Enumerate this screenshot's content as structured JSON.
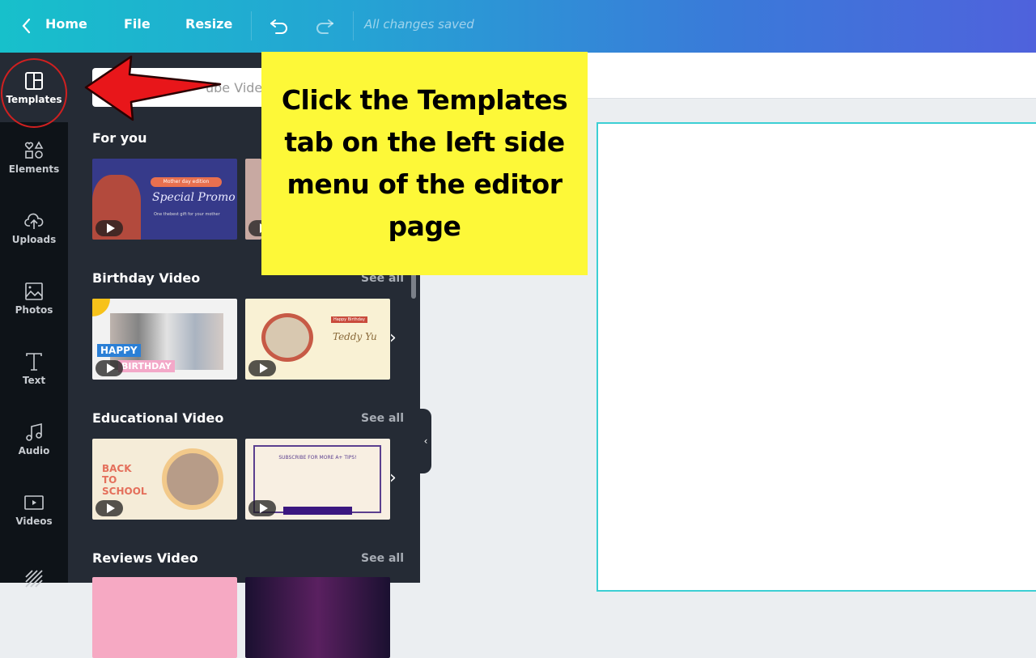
{
  "topbar": {
    "back_icon": "chevron-left-icon",
    "home": "Home",
    "file": "File",
    "resize": "Resize",
    "undo_icon": "undo-icon",
    "redo_icon": "redo-icon",
    "status": "All changes saved"
  },
  "rail": {
    "items": [
      {
        "label": "Templates",
        "icon": "templates-icon",
        "active": true
      },
      {
        "label": "Elements",
        "icon": "elements-icon"
      },
      {
        "label": "Uploads",
        "icon": "upload-cloud-icon"
      },
      {
        "label": "Photos",
        "icon": "photo-icon"
      },
      {
        "label": "Text",
        "icon": "text-icon"
      },
      {
        "label": "Audio",
        "icon": "music-note-icon"
      },
      {
        "label": "Videos",
        "icon": "video-icon"
      },
      {
        "label": "",
        "icon": "background-stripes-icon"
      }
    ]
  },
  "panel": {
    "search_value": "ube Vide",
    "sections": [
      {
        "title": "For you",
        "see_all": "",
        "thumbs": [
          {
            "name": "mother-day-promo",
            "caption_top": "Mother day edition",
            "caption_main": "Special Promo",
            "caption_sub": "One thebest gift for your mother",
            "bg": "#363a8a"
          },
          {
            "name": "for-you-second",
            "bg": "#c8a9a2"
          }
        ]
      },
      {
        "title": "Birthday Video",
        "see_all": "See all",
        "thumbs": [
          {
            "name": "happy-birthday-kids",
            "caption_top": "HAPPY",
            "caption_main": "BIRTHDAY",
            "bg": "#f2f2f2"
          },
          {
            "name": "happy-birthday-teddy",
            "caption_top": "Happy Birthday",
            "caption_main": "Teddy Yu",
            "bg": "#f9f1d4"
          }
        ]
      },
      {
        "title": "Educational Video",
        "see_all": "See all",
        "thumbs": [
          {
            "name": "back-to-school",
            "caption_main": "BACK TO SCHOOL",
            "bg": "#f5ecd8"
          },
          {
            "name": "subscribe-tips",
            "caption_main": "SUBSCRIBE FOR MORE A+ TIPS!",
            "bg": "#f8efe2"
          }
        ]
      },
      {
        "title": "Reviews Video",
        "see_all": "See all",
        "thumbs": [
          {
            "name": "reviews-pink",
            "bg": "#f6a9c3"
          },
          {
            "name": "reviews-dark",
            "bg": "#3a1a40"
          }
        ]
      }
    ]
  },
  "callout": {
    "text": "Click the Templates tab on the left side menu of the editor page"
  },
  "colors": {
    "callout_bg": "#fdf838",
    "annotation_red": "#e8161a",
    "canvas_border": "#3ccfd4"
  }
}
